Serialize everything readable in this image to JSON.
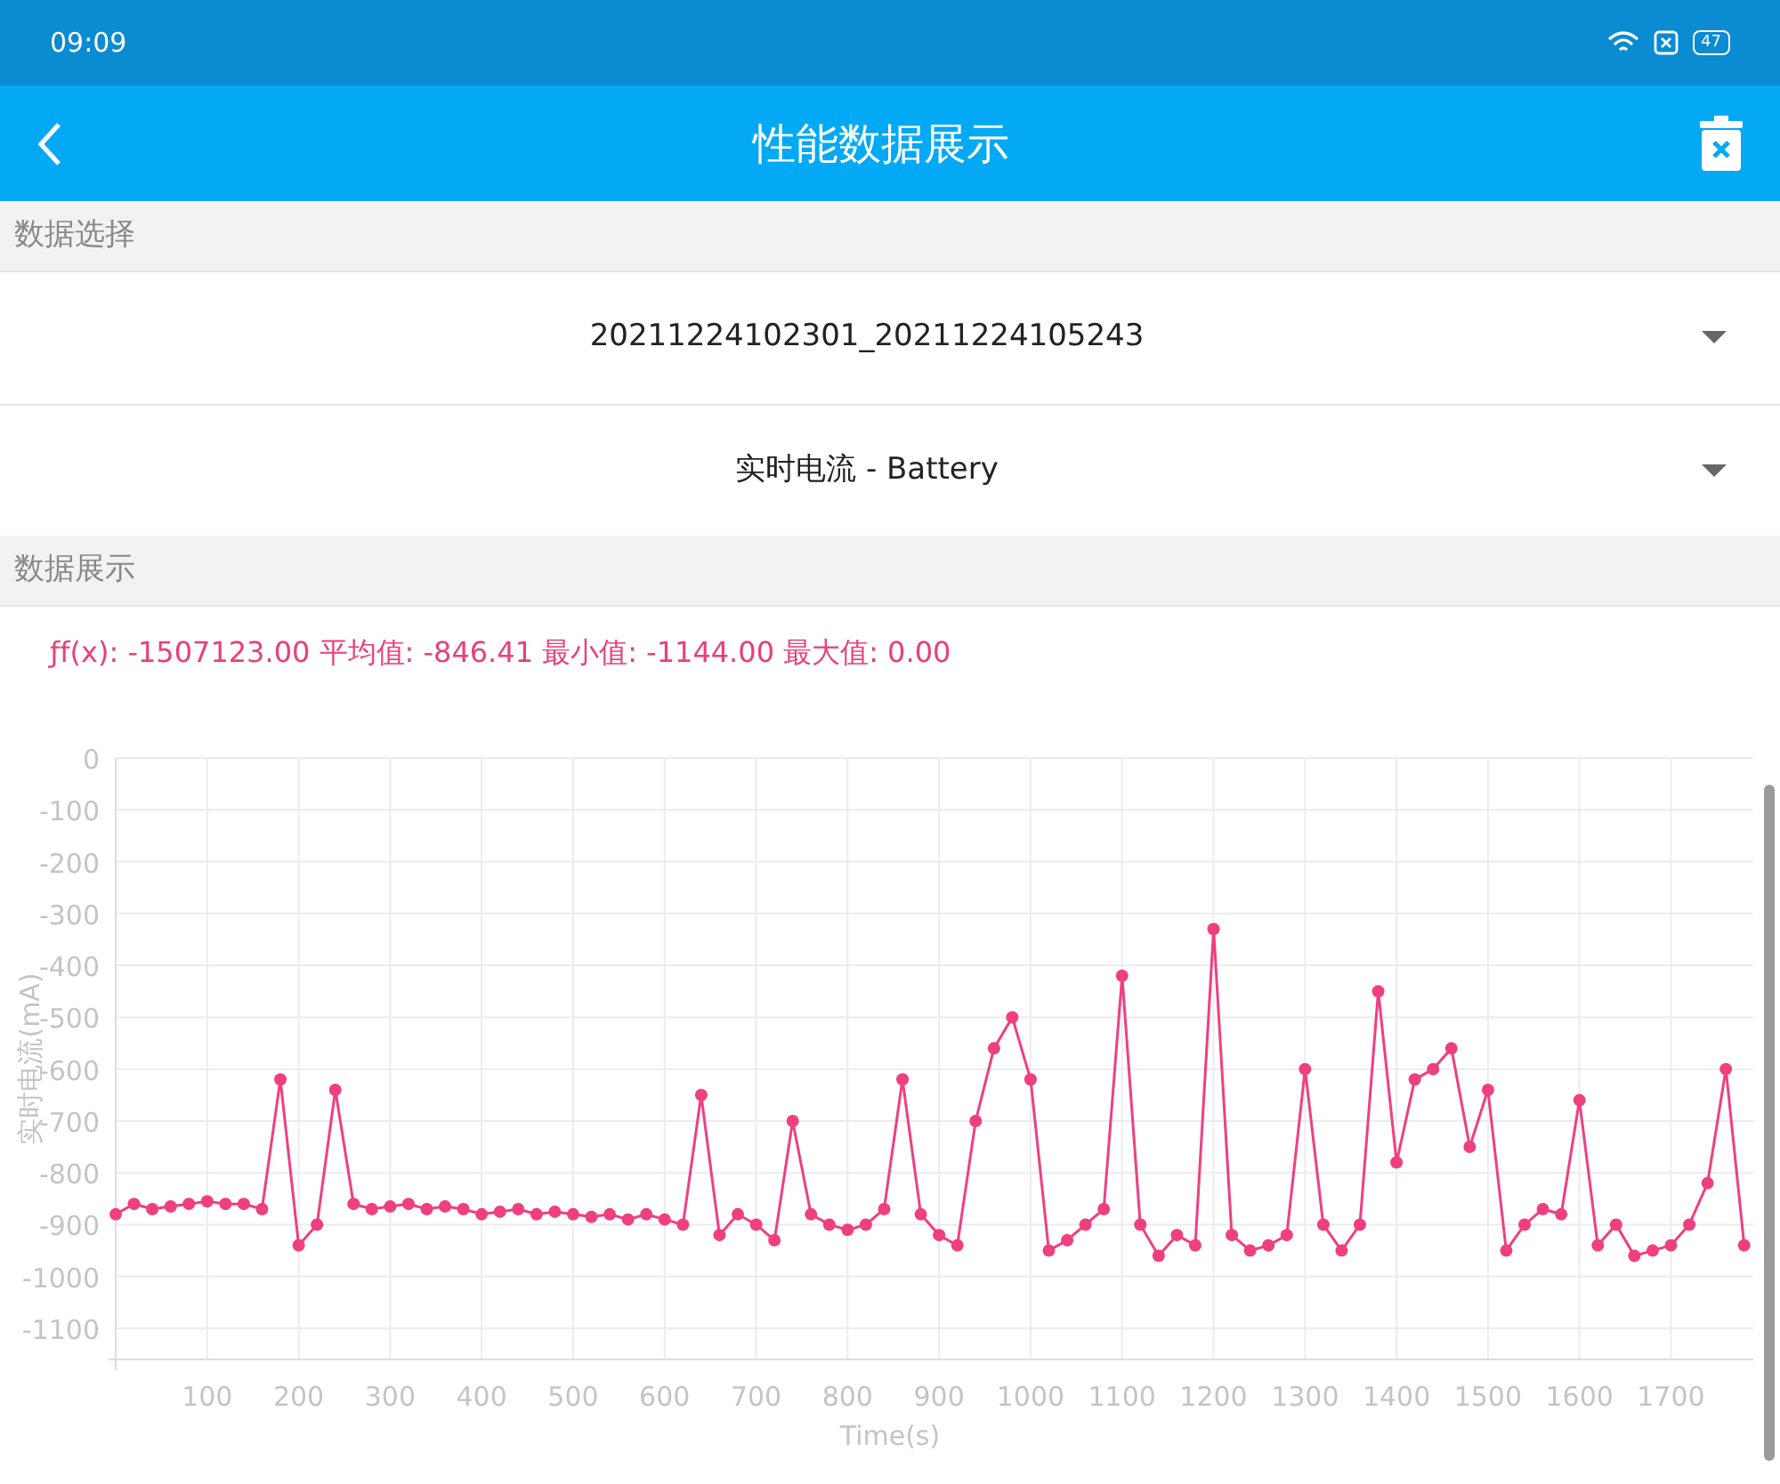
{
  "status_bar": {
    "time": "09:09",
    "battery": "47"
  },
  "toolbar": {
    "title": "性能数据展示"
  },
  "sections": [
    {
      "title": "数据选择"
    },
    {
      "title": "数据展示"
    }
  ],
  "selectors": [
    {
      "value": "20211224102301_20211224105243"
    },
    {
      "value": "实时电流 - Battery"
    }
  ],
  "summary": "ƒf(x): -1507123.00 平均值: -846.41 最小值: -1144.00 最大值: 0.00",
  "chart": {
    "chart_data": {
      "type": "line",
      "xlabel": "Time(s)",
      "ylabel": "实时电流(mA)",
      "x": [
        0,
        20,
        40,
        60,
        80,
        100,
        120,
        140,
        160,
        180,
        200,
        220,
        240,
        260,
        280,
        300,
        320,
        340,
        360,
        380,
        400,
        420,
        440,
        460,
        480,
        500,
        520,
        540,
        560,
        580,
        600,
        620,
        640,
        660,
        680,
        700,
        720,
        740,
        760,
        780,
        800,
        820,
        840,
        860,
        880,
        900,
        920,
        940,
        960,
        980,
        1000,
        1020,
        1040,
        1060,
        1080,
        1100,
        1120,
        1140,
        1160,
        1180,
        1200,
        1220,
        1240,
        1260,
        1280,
        1300,
        1320,
        1340,
        1360,
        1380,
        1400,
        1420,
        1440,
        1460,
        1480,
        1500,
        1520,
        1540,
        1560,
        1580,
        1600,
        1620,
        1640,
        1660,
        1680,
        1700,
        1720,
        1740,
        1760,
        1780
      ],
      "grid": true,
      "series": [
        {
          "color": "#ef3f7f",
          "marker": true,
          "values": [
            -880,
            -860,
            -870,
            -865,
            -860,
            -855,
            -860,
            -860,
            -870,
            -620,
            -940,
            -900,
            -640,
            -860,
            -870,
            -865,
            -860,
            -870,
            -865,
            -870,
            -880,
            -875,
            -870,
            -880,
            -875,
            -880,
            -885,
            -880,
            -890,
            -880,
            -890,
            -900,
            -650,
            -920,
            -880,
            -900,
            -930,
            -700,
            -880,
            -900,
            -910,
            -900,
            -870,
            -620,
            -880,
            -920,
            -940,
            -700,
            -560,
            -500,
            -620,
            -950,
            -930,
            -900,
            -870,
            -420,
            -900,
            -960,
            -920,
            -940,
            -330,
            -920,
            -950,
            -940,
            -920,
            -600,
            -900,
            -950,
            -900,
            -450,
            -780,
            -620,
            -600,
            -560,
            -750,
            -640,
            -950,
            -900,
            -870,
            -880,
            -660,
            -940,
            -900,
            -960,
            -950,
            -940,
            -900,
            -820,
            -600,
            -940
          ]
        }
      ],
      "xlim": [
        0,
        1790
      ],
      "ylim": [
        -1160,
        0
      ],
      "xticks": [
        100,
        200,
        300,
        400,
        500,
        600,
        700,
        800,
        900,
        1000,
        1100,
        1200,
        1300,
        1400,
        1500,
        1600,
        1700
      ],
      "yticks": [
        0,
        -100,
        -200,
        -300,
        -400,
        -500,
        -600,
        -700,
        -800,
        -900,
        -1000,
        -1100
      ]
    }
  }
}
